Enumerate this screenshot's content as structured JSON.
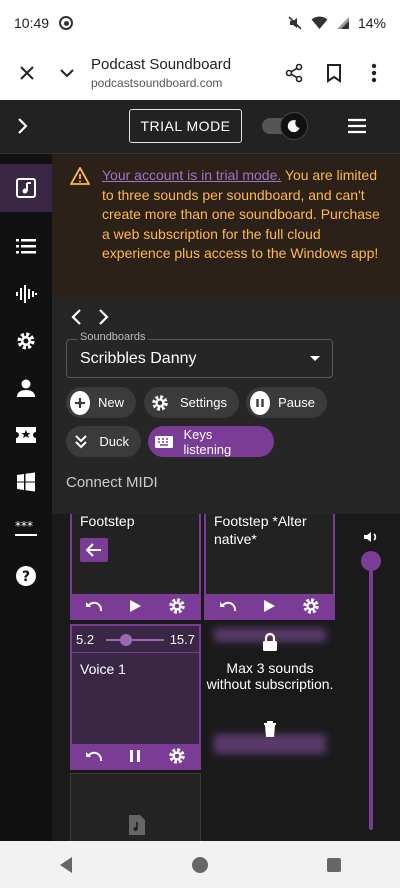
{
  "status_bar": {
    "time": "10:49",
    "battery": "14%"
  },
  "browser": {
    "title": "Podcast Soundboard",
    "url": "podcastsoundboard.com",
    "icons": [
      "close-icon",
      "chevron-down-icon",
      "share-icon",
      "bookmark-icon",
      "more-vertical-icon"
    ]
  },
  "header": {
    "trial_label": "TRIAL MODE"
  },
  "sidebar": {
    "items": [
      {
        "name": "sidebar-item-soundboard",
        "icon": "music-note-icon",
        "active": true
      },
      {
        "name": "sidebar-item-list",
        "icon": "list-icon",
        "active": false
      },
      {
        "name": "sidebar-item-waveform",
        "icon": "waveform-icon",
        "active": false
      },
      {
        "name": "sidebar-item-settings",
        "icon": "gear-icon",
        "active": false
      },
      {
        "name": "sidebar-item-account",
        "icon": "person-icon",
        "active": false
      },
      {
        "name": "sidebar-item-tickets",
        "icon": "ticket-star-icon",
        "active": false
      },
      {
        "name": "sidebar-item-windows",
        "icon": "windows-icon",
        "active": false
      },
      {
        "name": "sidebar-item-keys",
        "icon": "password-icon",
        "active": false
      },
      {
        "name": "sidebar-item-help",
        "icon": "help-icon",
        "active": false
      }
    ]
  },
  "alert": {
    "link_text": "Your account is in trial mode.",
    "message": " You are limited to three sounds per soundboard, and can't create more than one soundboard. Purchase a web subscription for the full cloud experience plus access to the Windows app!"
  },
  "soundboard": {
    "select_label": "Soundboards",
    "selected": "Scribbles Danny",
    "chips": {
      "new": "New",
      "settings": "Settings",
      "pause": "Pause",
      "duck": "Duck",
      "keys": "Keys listening"
    },
    "connect_midi": "Connect MIDI"
  },
  "tiles": {
    "footstep": "Footstep",
    "footstep_alt": "Footstep *Alter native*",
    "voice": "Voice 1",
    "voice_start": "5.2",
    "voice_end": "15.7",
    "locked_msg": "Max 3 sounds without subscription."
  },
  "colors": {
    "accent": "#7b3c95",
    "warning": "#ffb74d",
    "link": "#a274c4"
  }
}
